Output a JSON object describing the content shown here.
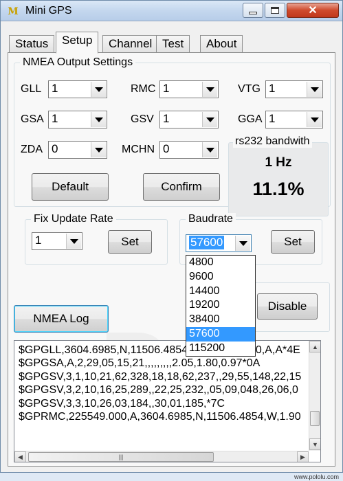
{
  "window": {
    "title": "Mini GPS",
    "close_glyph": "✕"
  },
  "tabs": [
    "Status",
    "Setup",
    "Channel",
    "Test",
    "About"
  ],
  "nmea": {
    "group_title": "NMEA Output Settings",
    "fields": {
      "gll": {
        "label": "GLL",
        "value": "1"
      },
      "rmc": {
        "label": "RMC",
        "value": "1"
      },
      "vtg": {
        "label": "VTG",
        "value": "1"
      },
      "gsa": {
        "label": "GSA",
        "value": "1"
      },
      "gsv": {
        "label": "GSV",
        "value": "1"
      },
      "gga": {
        "label": "GGA",
        "value": "1"
      },
      "zda": {
        "label": "ZDA",
        "value": "0"
      },
      "mchn": {
        "label": "MCHN",
        "value": "0"
      }
    },
    "default_label": "Default",
    "confirm_label": "Confirm"
  },
  "bandwidth": {
    "title": "rs232 bandwith",
    "rate": "1 Hz",
    "percent": "11.1%"
  },
  "fix_rate": {
    "title": "Fix Update Rate",
    "value": "1",
    "set_label": "Set"
  },
  "baudrate": {
    "title": "Baudrate",
    "value": "57600",
    "set_label": "Set",
    "options": [
      "4800",
      "9600",
      "14400",
      "19200",
      "38400",
      "57600",
      "115200"
    ],
    "selected_index": 5
  },
  "disable_label": "Disable",
  "nmea_log_label": "NMEA Log",
  "log_lines": [
    "$GPGLL,3604.6985,N,11506.4854,W,225549.000,A,A*4E",
    "$GPGSA,A,2,29,05,15,21,,,,,,,,,2.05,1.80,0.97*0A",
    "$GPGSV,3,1,10,21,62,328,18,18,62,237,,29,55,148,22,15",
    "$GPGSV,3,2,10,16,25,289,,22,25,232,,05,09,048,26,06,0",
    "$GPGSV,3,3,10,26,03,184,,30,01,185,*7C",
    "$GPRMC,225549.000,A,3604.6985,N,11506.4854,W,1.90"
  ],
  "scrollbar": {
    "left_arrow": "◀",
    "right_arrow": "▶",
    "up_arrow": "▲",
    "down_arrow": "▼",
    "grip": "|||"
  },
  "watermark": "www.pololu.com",
  "icons": {
    "app": "mini-gps-app-icon",
    "close": "close-icon",
    "minimize": "minimize-icon",
    "maximize": "maximize-icon",
    "dropdown": "chevron-down-icon"
  }
}
